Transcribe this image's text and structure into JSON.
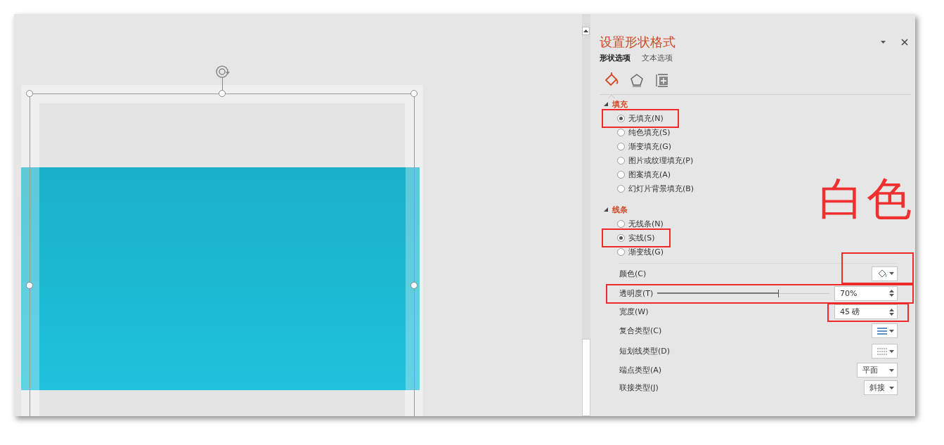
{
  "panel": {
    "title": "设置形状格式",
    "tabs": [
      {
        "label": "形状选项",
        "selected": true
      },
      {
        "label": "文本选项",
        "selected": false
      }
    ],
    "icon_tabs": [
      {
        "kind": "fill",
        "selected": true
      },
      {
        "kind": "effects",
        "selected": false
      },
      {
        "kind": "size",
        "selected": false
      }
    ],
    "sections": [
      {
        "title": "填充",
        "expanded": true,
        "options": [
          {
            "label": "无填充(N)",
            "selected": true,
            "highlighted": true
          },
          {
            "label": "纯色填充(S)",
            "selected": false,
            "highlighted": false
          },
          {
            "label": "渐变填充(G)",
            "selected": false,
            "highlighted": false
          },
          {
            "label": "图片或纹理填充(P)",
            "selected": false,
            "highlighted": false
          },
          {
            "label": "图案填充(A)",
            "selected": false,
            "highlighted": false
          },
          {
            "label": "幻灯片背景填充(B)",
            "selected": false,
            "highlighted": false
          }
        ]
      },
      {
        "title": "线条",
        "expanded": true,
        "options": [
          {
            "label": "无线条(N)",
            "selected": false,
            "highlighted": false
          },
          {
            "label": "实线(S)",
            "selected": true,
            "highlighted": true
          },
          {
            "label": "渐变线(G)",
            "selected": false,
            "highlighted": false
          }
        ],
        "properties": [
          {
            "kind": "color",
            "label": "颜色(C)",
            "highlighted": true
          },
          {
            "kind": "slider",
            "label": "透明度(T)",
            "level": 0.7,
            "value": "70%",
            "highlighted": true
          },
          {
            "kind": "spin",
            "label": "宽度(W)",
            "value": "45 磅",
            "highlighted": true
          },
          {
            "kind": "compound",
            "label": "复合类型(C)",
            "highlighted": false
          },
          {
            "kind": "dash",
            "label": "短划线类型(D)",
            "highlighted": false
          },
          {
            "kind": "dropdown",
            "label": "端点类型(A)",
            "value": "平面",
            "highlighted": false
          },
          {
            "kind": "dropdown",
            "label": "联接类型(J)",
            "value": "斜接",
            "highlighted": false
          }
        ]
      }
    ]
  },
  "annotation": {
    "text": "白色"
  }
}
